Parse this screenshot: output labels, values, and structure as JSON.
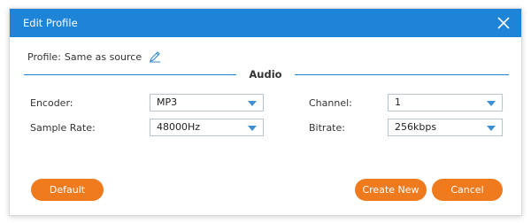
{
  "dialog": {
    "title": "Edit Profile",
    "close_icon": "close-icon",
    "accent_color": "#1d84d8",
    "button_color": "#f07a1e"
  },
  "profile": {
    "label": "Profile:",
    "value": "Same as source",
    "edit_icon": "pencil-icon"
  },
  "section": {
    "title": "Audio"
  },
  "fields": {
    "encoder": {
      "label": "Encoder:",
      "value": "MP3"
    },
    "channel": {
      "label": "Channel:",
      "value": "1"
    },
    "sample_rate": {
      "label": "Sample Rate:",
      "value": "48000Hz"
    },
    "bitrate": {
      "label": "Bitrate:",
      "value": "256kbps"
    }
  },
  "buttons": {
    "default": "Default",
    "create_new": "Create New",
    "cancel": "Cancel"
  }
}
